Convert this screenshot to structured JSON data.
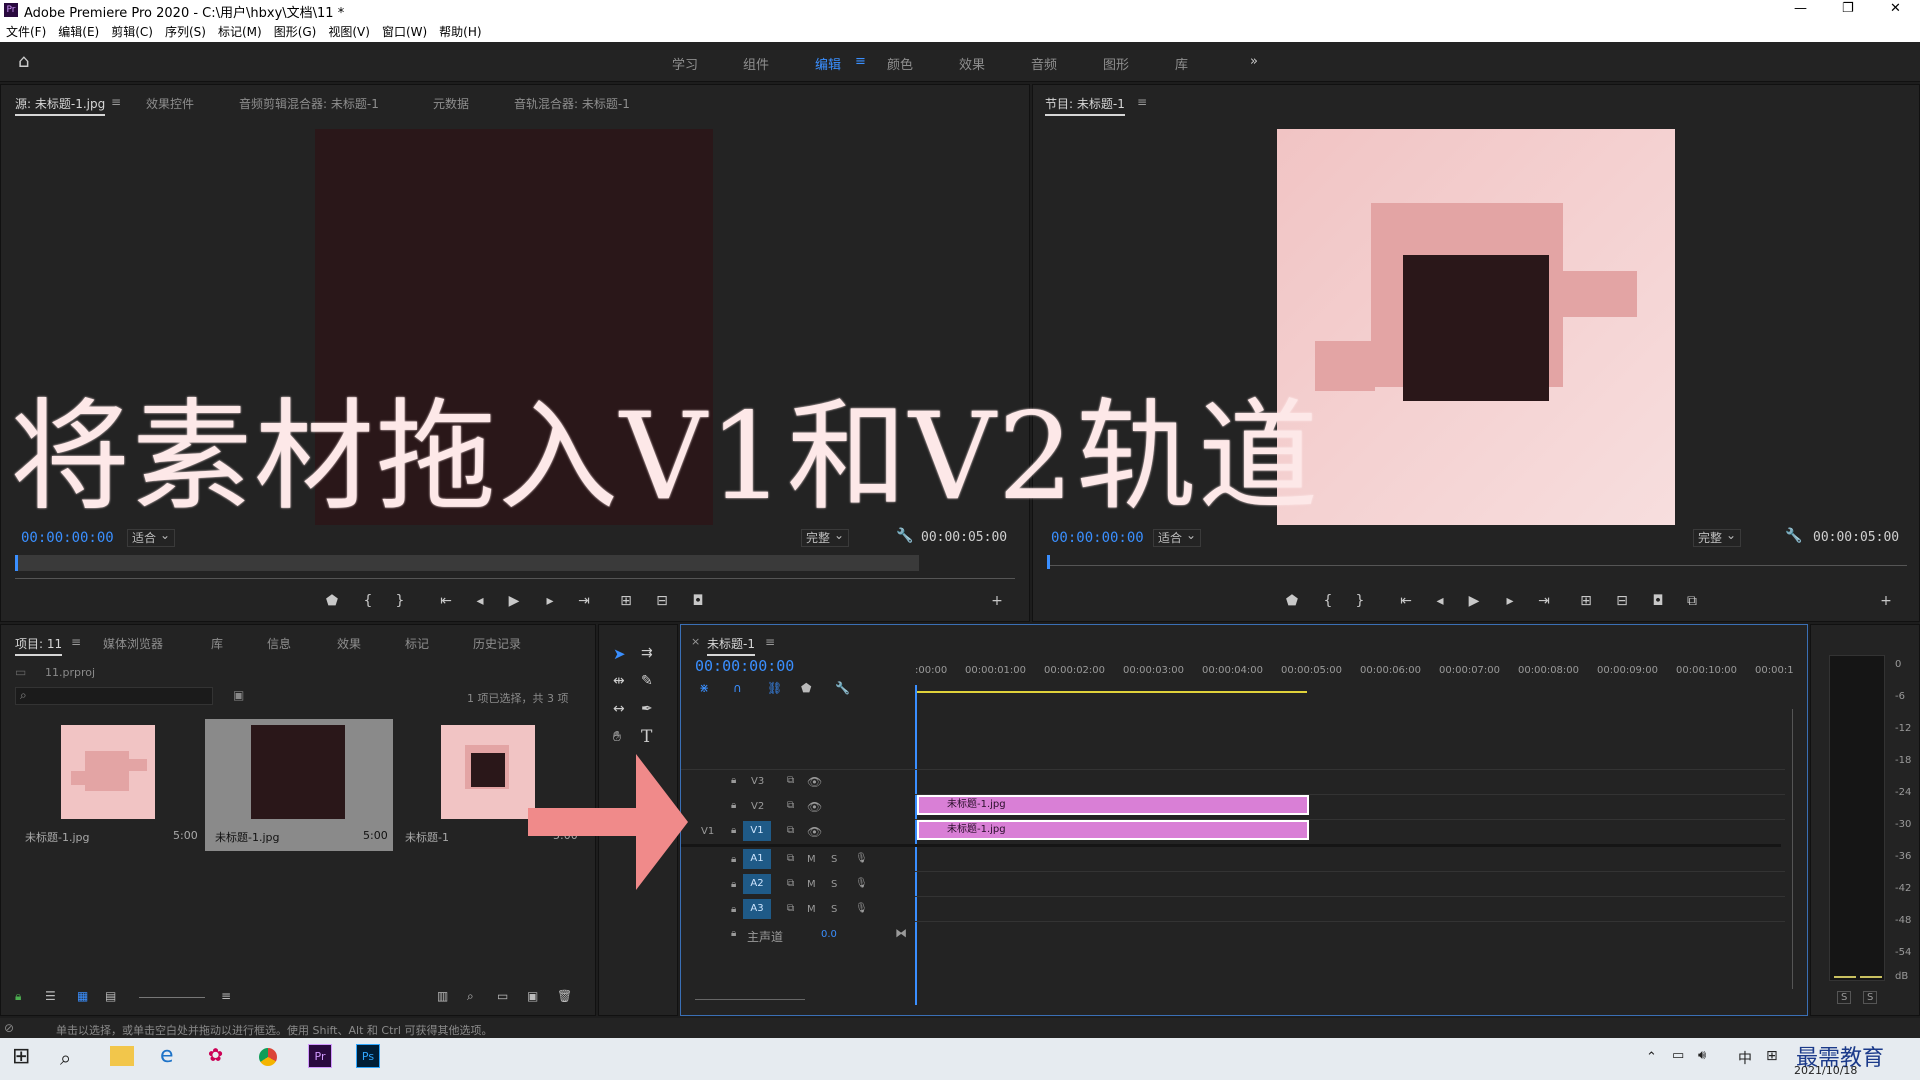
{
  "window": {
    "title": "Adobe Premiere Pro 2020 - C:\\用户\\hbxy\\文档\\11 *",
    "controls": [
      "—",
      "❐",
      "✕"
    ]
  },
  "menu": [
    "文件(F)",
    "编辑(E)",
    "剪辑(C)",
    "序列(S)",
    "标记(M)",
    "图形(G)",
    "视图(V)",
    "窗口(W)",
    "帮助(H)"
  ],
  "workspaces": {
    "items": [
      "学习",
      "组件",
      "编辑",
      "颜色",
      "效果",
      "音频",
      "图形",
      "库"
    ],
    "active": "编辑",
    "more": "»"
  },
  "source": {
    "tabs": [
      "源: 未标题-1.jpg",
      "效果控件",
      "音频剪辑混合器: 未标题-1",
      "元数据",
      "音轨混合器: 未标题-1"
    ],
    "timecode": "00:00:00:00",
    "fit": "适合",
    "quality": "完整",
    "duration": "00:00:05:00"
  },
  "program": {
    "tab": "节目: 未标题-1",
    "timecode": "00:00:00:00",
    "fit": "适合",
    "quality": "完整",
    "duration": "00:00:05:00"
  },
  "project": {
    "tabs": [
      "项目: 11",
      "媒体浏览器",
      "库",
      "信息",
      "效果",
      "标记",
      "历史记录"
    ],
    "file": "11.prproj",
    "selection": "1 项已选择，共 3 项",
    "items": [
      {
        "name": "未标题-1.jpg",
        "dur": "5:00"
      },
      {
        "name": "未标题-1.jpg",
        "dur": "5:00"
      },
      {
        "name": "未标题-1",
        "dur": "5:00"
      }
    ]
  },
  "timeline": {
    "tab": "未标题-1",
    "timecode": "00:00:00:00",
    "ruler": [
      ":00:00",
      "00:00:01:00",
      "00:00:02:00",
      "00:00:03:00",
      "00:00:04:00",
      "00:00:05:00",
      "00:00:06:00",
      "00:00:07:00",
      "00:00:08:00",
      "00:00:09:00",
      "00:00:10:00",
      "00:00:1"
    ],
    "video_tracks": [
      "V3",
      "V2",
      "V1"
    ],
    "audio_tracks": [
      "A1",
      "A2",
      "A3"
    ],
    "master": "主声道",
    "master_value": "0.0",
    "src_patch": "V1",
    "clips": [
      {
        "track": "V2",
        "name": "未标题-1.jpg"
      },
      {
        "track": "V1",
        "name": "未标题-1.jpg"
      }
    ],
    "ms": [
      "M",
      "S"
    ]
  },
  "meter": {
    "labels": [
      "0",
      "-6",
      "-12",
      "-18",
      "-24",
      "-30",
      "-36",
      "-42",
      "-48",
      "-54",
      "dB"
    ],
    "solo": [
      "S",
      "S"
    ]
  },
  "overlay": {
    "caption": "将素材拖入V1和V2轨道"
  },
  "status": "单击以选择，或单击空白处并拖动以进行框选。使用 Shift、Alt 和 Ctrl 可获得其他选项。",
  "taskbar": {
    "clock": "2021/10/18",
    "ime": "中",
    "watermark": "最需教育"
  },
  "colors": {
    "accent": "#3a8fff",
    "clip": "#d97fd6",
    "bg": "#232323",
    "pink": "#e8a9a9",
    "dark": "#2a1719"
  }
}
